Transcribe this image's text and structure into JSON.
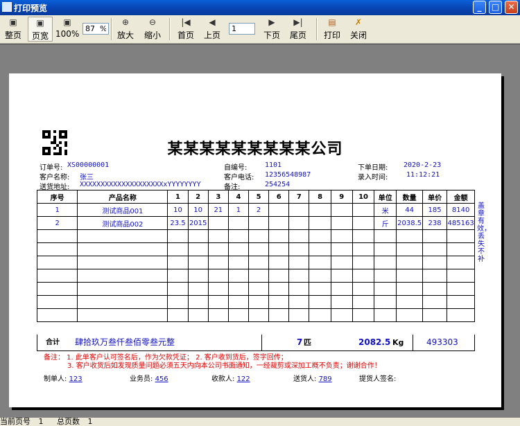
{
  "window": {
    "title": "打印预览",
    "min_label": "_",
    "max_label": "□",
    "close_label": "✕"
  },
  "toolbar": {
    "whole_page": "整页",
    "page_width": "页宽",
    "zoom_100": "100%",
    "zoom_value": "87  %",
    "zoom_in": "放大",
    "zoom_out": "缩小",
    "first_page": "首页",
    "prev_page": "上页",
    "page_value": "1",
    "next_page": "下页",
    "last_page": "尾页",
    "print": "打印",
    "close": "关闭"
  },
  "doc": {
    "company": "某某某某某某某某某公司",
    "order_no_label": "订单号:",
    "order_no": "XS00000001",
    "customer_label": "客户名称:",
    "customer": "张三",
    "address_label": "送货地址:",
    "address": "XXXXXXXXXXXXXXXXXXXXxYYYYYYYY",
    "self_no_label": "自编号:",
    "self_no": "1101",
    "phone_label": "客户电话:",
    "phone": "12356548987",
    "remark_label": "备注:",
    "remark": "254254",
    "date_label": "下单日期:",
    "date": "2020-2-23",
    "entry_time_label": "录入时间:",
    "entry_time": "11:12:21",
    "columns": [
      "序号",
      "产品名称",
      "1",
      "2",
      "3",
      "4",
      "5",
      "6",
      "7",
      "8",
      "9",
      "10",
      "单位",
      "数量",
      "单价",
      "金额"
    ],
    "rows": [
      [
        "1",
        "测试商品001",
        "10",
        "10",
        "21",
        "1",
        "2",
        "",
        "",
        "",
        "",
        "",
        "米",
        "44",
        "185",
        "8140"
      ],
      [
        "2",
        "测试商品002",
        "23.5",
        "2015",
        "",
        "",
        "",
        "",
        "",
        "",
        "",
        "",
        "斤",
        "2038.5",
        "238",
        "485163"
      ],
      [
        "",
        "",
        "",
        "",
        "",
        "",
        "",
        "",
        "",
        "",
        "",
        "",
        "",
        "",
        "",
        ""
      ],
      [
        "",
        "",
        "",
        "",
        "",
        "",
        "",
        "",
        "",
        "",
        "",
        "",
        "",
        "",
        "",
        ""
      ],
      [
        "",
        "",
        "",
        "",
        "",
        "",
        "",
        "",
        "",
        "",
        "",
        "",
        "",
        "",
        "",
        ""
      ],
      [
        "",
        "",
        "",
        "",
        "",
        "",
        "",
        "",
        "",
        "",
        "",
        "",
        "",
        "",
        "",
        ""
      ],
      [
        "",
        "",
        "",
        "",
        "",
        "",
        "",
        "",
        "",
        "",
        "",
        "",
        "",
        "",
        "",
        ""
      ],
      [
        "",
        "",
        "",
        "",
        "",
        "",
        "",
        "",
        "",
        "",
        "",
        "",
        "",
        "",
        "",
        ""
      ],
      [
        "",
        "",
        "",
        "",
        "",
        "",
        "",
        "",
        "",
        "",
        "",
        "",
        "",
        "",
        "",
        ""
      ]
    ],
    "total_label": "合计",
    "total_in_words": "肆拾玖万叁仟叁佰零叁元整",
    "total_pieces": "7",
    "pieces_unit": "匹",
    "total_weight": "2082.5",
    "weight_unit": "Kg",
    "total_amount": "493303",
    "side_note": "盖章有效，丢失不补",
    "note_line1": "备注： 1. 此单客户认可签名后，作为欠款凭证； 2. 客户收到货后，签字回传；",
    "note_line2": "3. 客户收货后如发现质量问题必须五天内向本公司书面通知，一经裁剪或深加工概不负责；谢谢合作！",
    "maker_label": "制单人:",
    "maker": "123",
    "sales_label": "业务员:",
    "sales": "456",
    "receiver_label": "收款人:",
    "receiver": "122",
    "deliverer_label": "送货人:",
    "deliverer": "789",
    "pickup_label": "提货人签名:"
  },
  "status": {
    "current_page_label": "当前页号",
    "current_page": "1",
    "total_pages_label": "总页数",
    "total_pages": "1"
  }
}
